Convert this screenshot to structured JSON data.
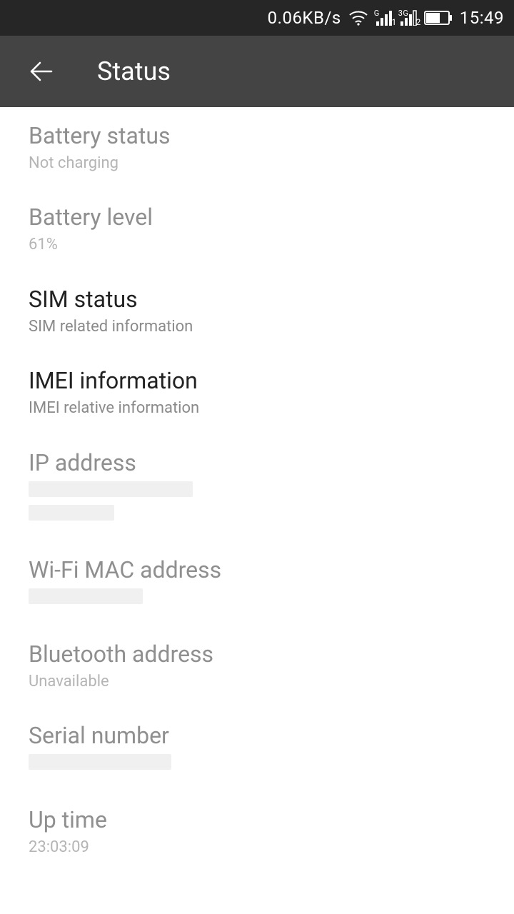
{
  "statusbar": {
    "net_speed": "0.06KB/s",
    "time": "15:49",
    "sim1_type": "G",
    "sim1_sub": "1",
    "sim2_type": "3G",
    "sim2_sub": "2"
  },
  "appbar": {
    "title": "Status"
  },
  "items": {
    "battery_status": {
      "title": "Battery status",
      "sub": "Not charging"
    },
    "battery_level": {
      "title": "Battery level",
      "sub": "61%"
    },
    "sim_status": {
      "title": "SIM status",
      "sub": "SIM related information"
    },
    "imei_info": {
      "title": "IMEI information",
      "sub": "IMEI relative information"
    },
    "ip_address": {
      "title": "IP address"
    },
    "wifi_mac": {
      "title": "Wi-Fi MAC address"
    },
    "bluetooth": {
      "title": "Bluetooth address",
      "sub": "Unavailable"
    },
    "serial": {
      "title": "Serial number"
    },
    "uptime": {
      "title": "Up time",
      "sub": "23:03:09"
    }
  }
}
